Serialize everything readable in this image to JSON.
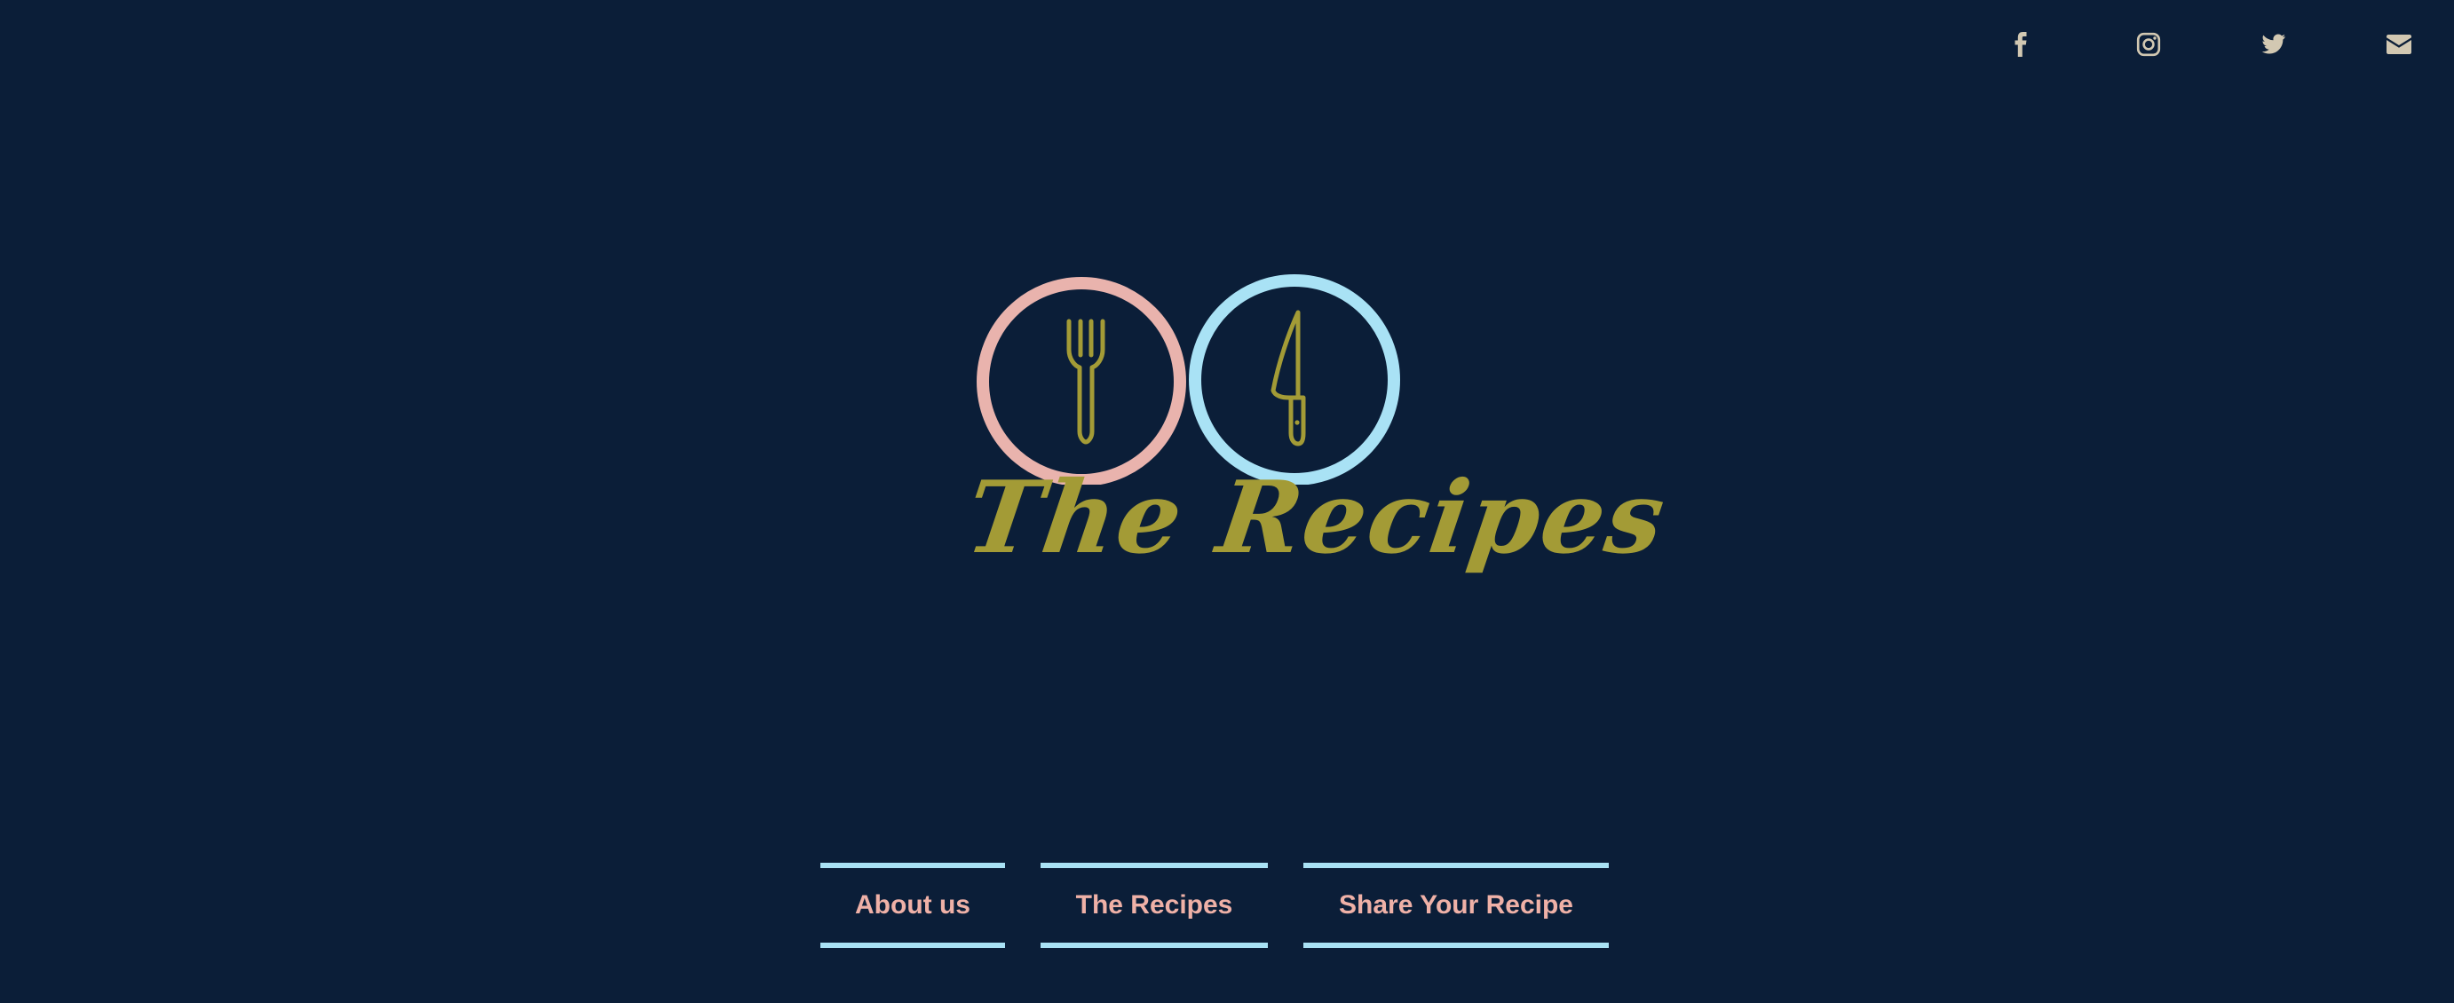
{
  "colors": {
    "background": "#0b1e38",
    "social_icon": "#d2c8b2",
    "ring_pink": "#e9b3ad",
    "ring_blue": "#a9e2f5",
    "brand_olive": "#a39b36",
    "nav_text": "#efb1a7",
    "nav_border": "#a9e2f5"
  },
  "social": {
    "icons": [
      "facebook-icon",
      "instagram-icon",
      "twitter-icon",
      "email-icon"
    ]
  },
  "logo": {
    "wordmark": "The Recipes",
    "icons": [
      "fork-icon",
      "knife-icon"
    ]
  },
  "nav": {
    "items": [
      {
        "label": "About us"
      },
      {
        "label": "The Recipes"
      },
      {
        "label": "Share Your Recipe"
      }
    ]
  }
}
